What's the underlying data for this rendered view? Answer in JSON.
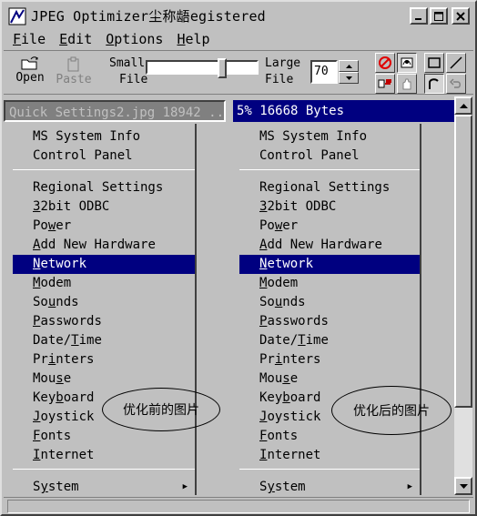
{
  "window": {
    "title": "JPEG Optimizer尘称龉egistered",
    "icon": "jpeg-optimizer-app-icon"
  },
  "menubar": [
    {
      "label": "File",
      "key": "F",
      "rest": "ile"
    },
    {
      "label": "Edit",
      "key": "E",
      "rest": "dit"
    },
    {
      "label": "Options",
      "key": "O",
      "rest": "ptions"
    },
    {
      "label": "Help",
      "key": "H",
      "rest": "elp"
    }
  ],
  "toolbar": {
    "open_label": "Open",
    "paste_label": "Paste",
    "small_label_1": "Small",
    "small_label_2": "File",
    "large_label_1": "Large",
    "large_label_2": "File",
    "quality_value": "70",
    "quality_fraction": 0.7
  },
  "left_pane": {
    "header": "Quick Settings2.jpg 18942 ...",
    "bubble_text": "优化前的图片"
  },
  "right_pane": {
    "header": "5% 16668 Bytes",
    "bubble_text": "优化后的图片"
  },
  "image_menu": {
    "group1": [
      {
        "pre": "MS System Info",
        "u": "",
        "post": ""
      },
      {
        "pre": "Control Panel",
        "u": "",
        "post": ""
      }
    ],
    "group2": [
      {
        "pre": "Regional Settings",
        "u": "",
        "post": ""
      },
      {
        "pre": "",
        "u": "3",
        "post": "2bit ODBC"
      },
      {
        "pre": "Po",
        "u": "w",
        "post": "er"
      },
      {
        "pre": "",
        "u": "A",
        "post": "dd New Hardware"
      },
      {
        "pre": "",
        "u": "N",
        "post": "etwork"
      },
      {
        "pre": "",
        "u": "M",
        "post": "odem"
      },
      {
        "pre": "So",
        "u": "u",
        "post": "nds"
      },
      {
        "pre": "",
        "u": "P",
        "post": "asswords"
      },
      {
        "pre": "Date/",
        "u": "T",
        "post": "ime"
      },
      {
        "pre": "Pr",
        "u": "i",
        "post": "nters"
      },
      {
        "pre": "Mou",
        "u": "s",
        "post": "e"
      },
      {
        "pre": "Key",
        "u": "b",
        "post": "oard"
      },
      {
        "pre": "",
        "u": "J",
        "post": "oystick"
      },
      {
        "pre": "",
        "u": "F",
        "post": "onts"
      },
      {
        "pre": "",
        "u": "I",
        "post": "nternet"
      }
    ],
    "group3": [
      {
        "pre": "S",
        "u": "y",
        "post": "stem"
      }
    ],
    "selected_item": "Network"
  },
  "colors": {
    "face": "#c0c0c0",
    "highlight": "#000080"
  }
}
